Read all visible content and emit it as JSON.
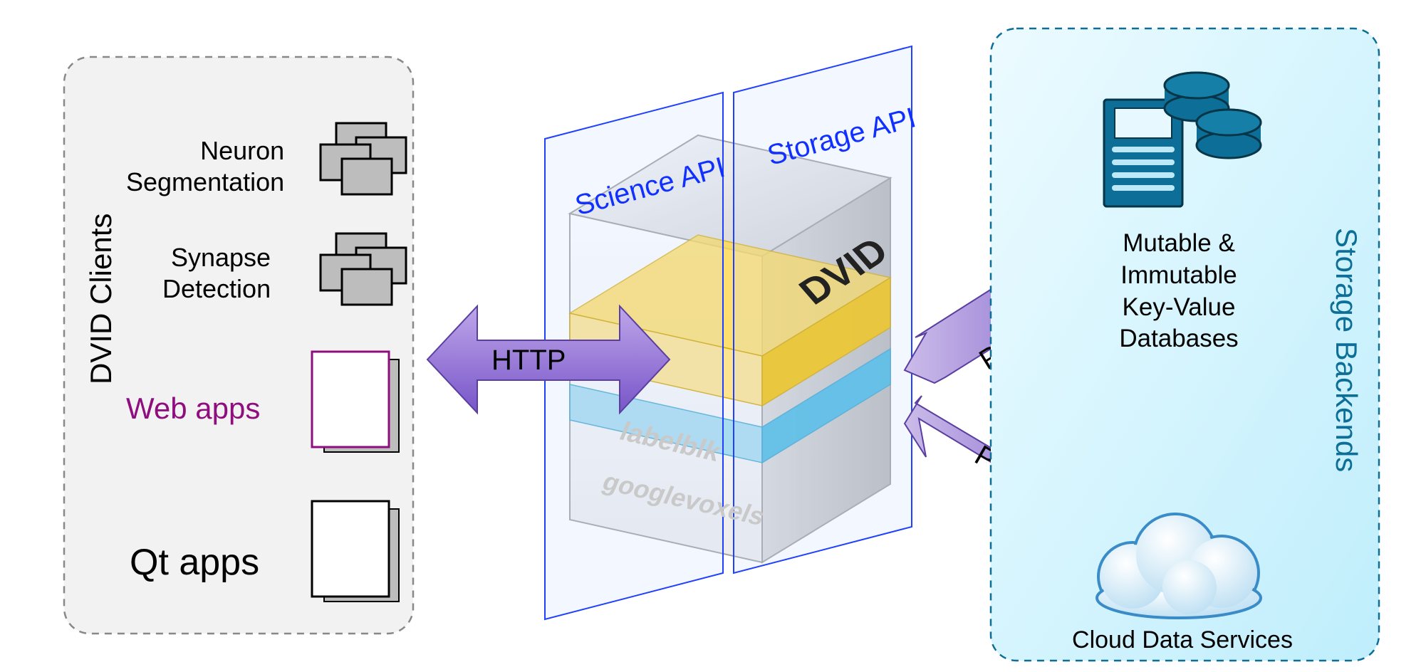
{
  "leftPanel": {
    "title": "DVID Clients",
    "items": {
      "neuron": "Neuron\nSegmentation",
      "synapse": "Synapse\nDetection",
      "web": "Web apps",
      "qt": "Qt apps"
    }
  },
  "center": {
    "scienceApi": "Science API",
    "storageApi": "Storage API",
    "dvid": "DVID",
    "labelblk": "labelblk",
    "googlevoxels": "googlevoxels"
  },
  "arrows": {
    "http": "HTTP",
    "persist": "Persist",
    "proxy": "Proxy"
  },
  "rightPanel": {
    "title": "Storage Backends",
    "db": "Mutable &\nImmutable\nKey-Value\nDatabases",
    "cloud": "Cloud Data Services"
  }
}
